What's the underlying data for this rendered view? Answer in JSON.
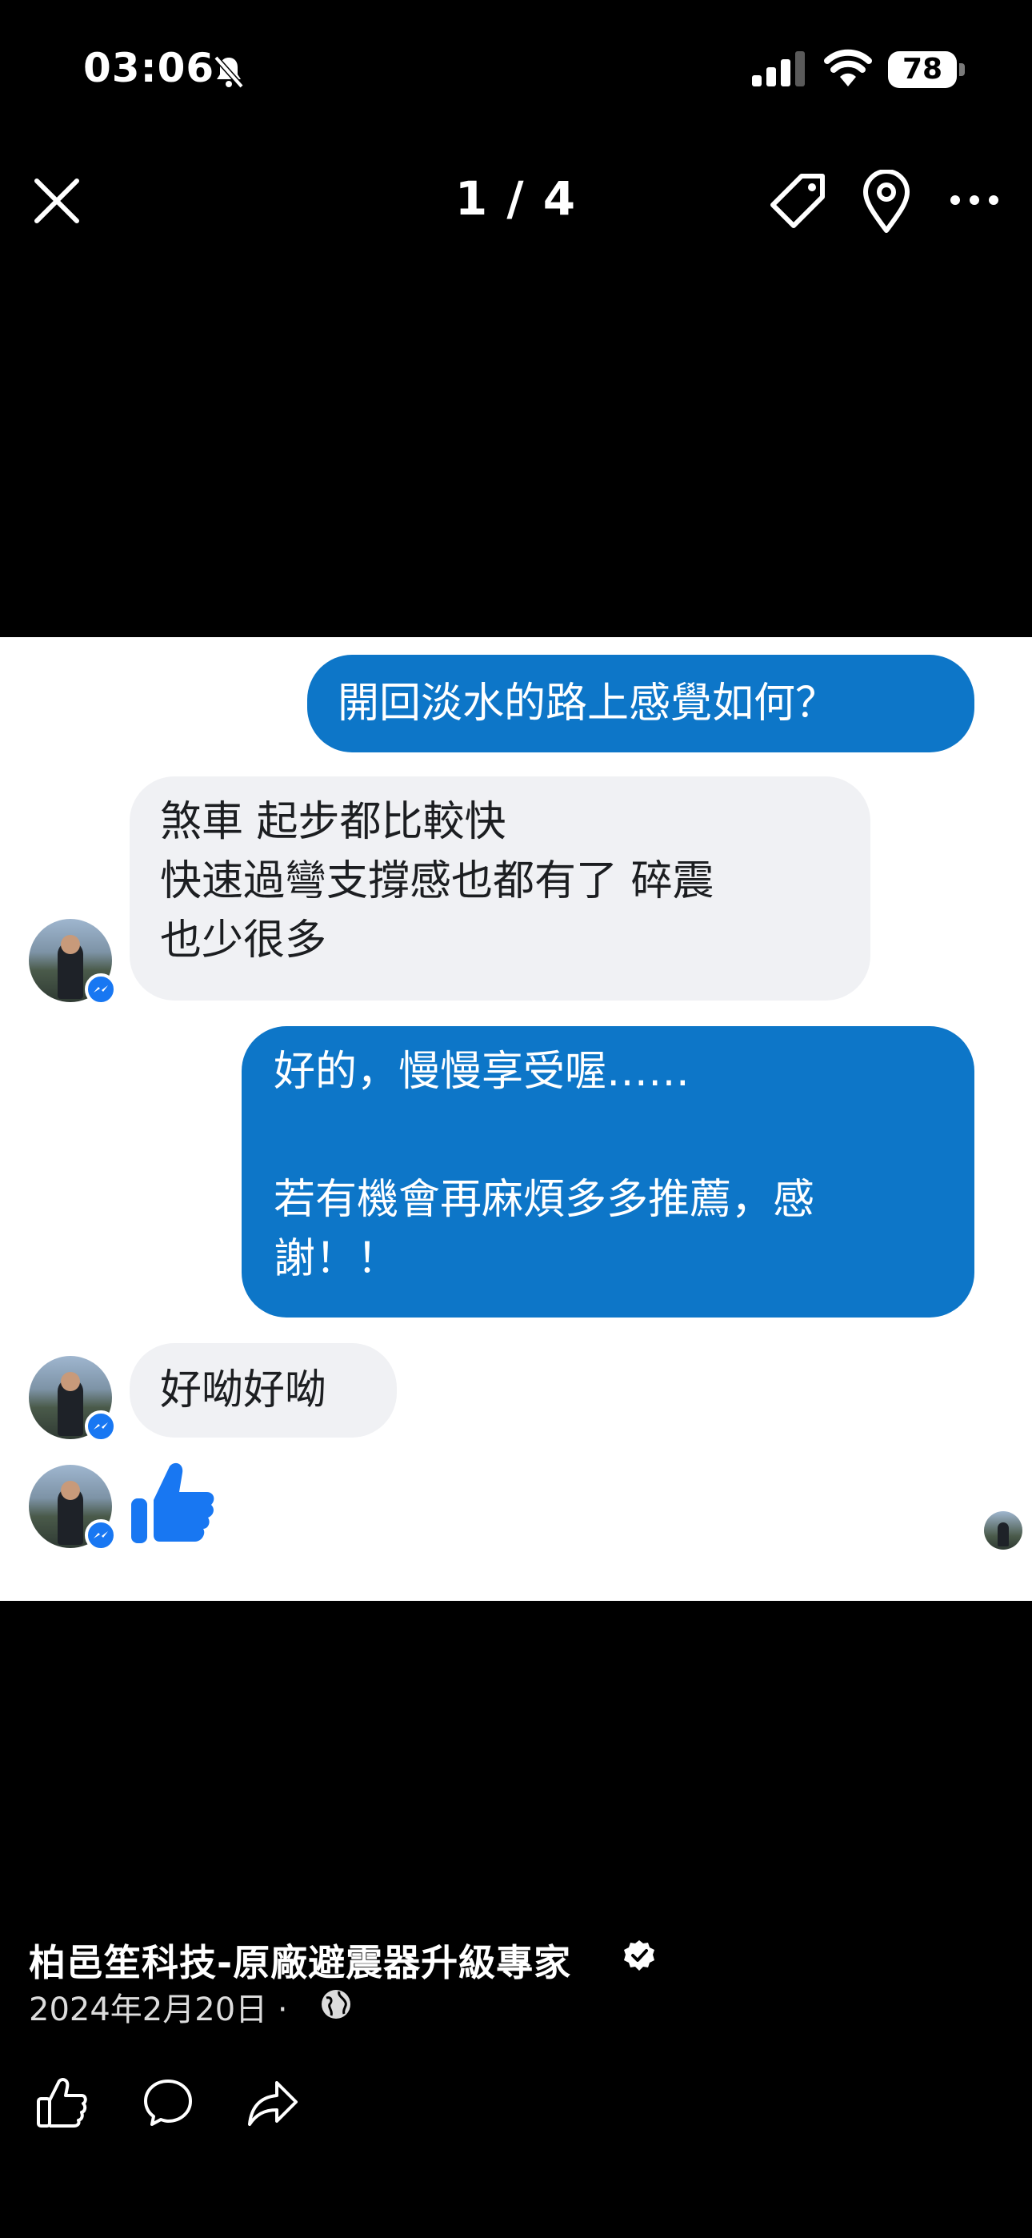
{
  "status_bar": {
    "time": "03:06",
    "battery": "78",
    "icons": [
      "bell-slash-icon",
      "cellular-signal-icon",
      "wifi-icon",
      "battery-icon"
    ]
  },
  "viewer": {
    "counter": "1 / 4",
    "icons": [
      "close-icon",
      "tag-icon",
      "location-icon",
      "more-icon"
    ]
  },
  "chat": {
    "outgoing_color": "#0d76c8",
    "incoming_color": "#f0f1f4",
    "messages": [
      {
        "from": "sender",
        "lines": [
          "開回淡水的路上感覺如何？"
        ]
      },
      {
        "from": "contact",
        "lines": [
          "煞車 起步都比較快",
          "快速過彎支撐感也都有了 碎震",
          "也少很多"
        ]
      },
      {
        "from": "sender",
        "lines": [
          "好的，慢慢享受喔……",
          "若有機會再麻煩多多推薦，感",
          "謝！！"
        ]
      },
      {
        "from": "contact",
        "lines": [
          "好呦好呦"
        ]
      },
      {
        "from": "contact",
        "reaction": "thumbs-up-icon"
      }
    ]
  },
  "post": {
    "author": "柏邑笙科技-原廠避震器升級專家",
    "date": "2024年2月20日 ·",
    "icons": [
      "verified-icon",
      "globe-icon"
    ]
  },
  "actions": {
    "icons": [
      "like-icon",
      "comment-icon",
      "share-icon"
    ]
  }
}
